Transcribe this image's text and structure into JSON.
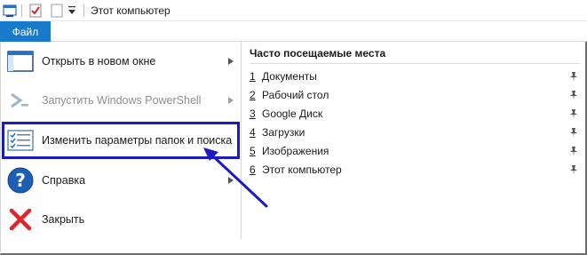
{
  "titlebar": {
    "title": "Этот компьютер",
    "icons": [
      "explorer-icon",
      "properties-check-icon",
      "new-folder-icon",
      "customize-dropdown-icon"
    ]
  },
  "ribbon": {
    "file_tab": "Файл",
    "accent_color": "#1979ca"
  },
  "file_menu": {
    "items": [
      {
        "label": "Открыть в новом окне",
        "icon": "new-window-icon",
        "has_submenu": true,
        "disabled": false
      },
      {
        "label": "Запустить Windows PowerShell",
        "icon": "powershell-icon",
        "has_submenu": true,
        "disabled": true
      },
      {
        "label": "Изменить параметры папок и поиска",
        "icon": "folder-options-icon",
        "has_submenu": false,
        "disabled": false,
        "highlighted": true
      },
      {
        "label": "Справка",
        "icon": "help-icon",
        "has_submenu": true,
        "disabled": false
      },
      {
        "label": "Закрыть",
        "icon": "close-icon",
        "has_submenu": false,
        "disabled": false
      }
    ]
  },
  "frequent_places": {
    "header": "Часто посещаемые места",
    "items": [
      {
        "num": "1",
        "label": "Документы"
      },
      {
        "num": "2",
        "label": "Рабочий стол"
      },
      {
        "num": "3",
        "label": "Google Диск"
      },
      {
        "num": "4",
        "label": "Загрузки"
      },
      {
        "num": "5",
        "label": "Изображения"
      },
      {
        "num": "6",
        "label": "Этот компьютер"
      }
    ]
  },
  "annotation": {
    "highlight_color": "#1b1bc2"
  }
}
